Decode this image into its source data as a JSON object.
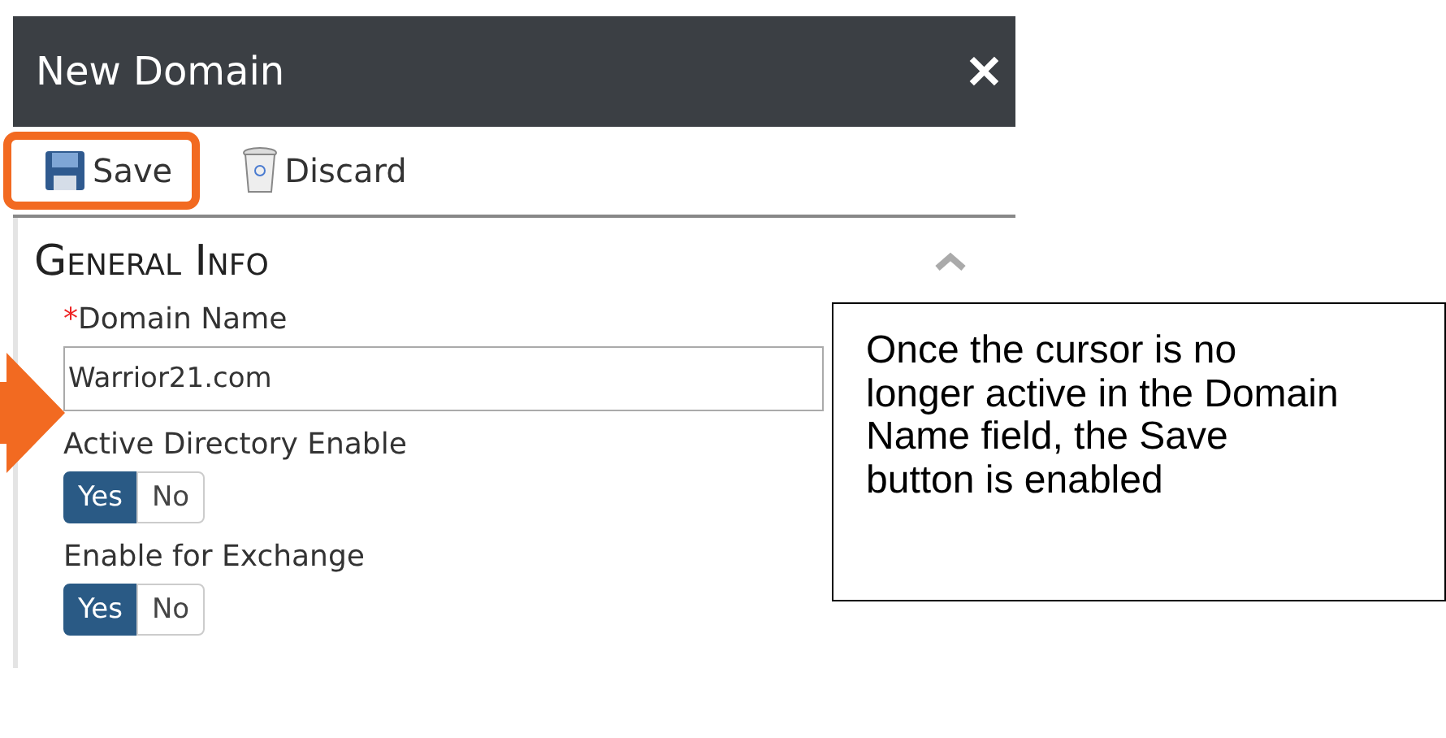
{
  "dialog": {
    "title": "New Domain",
    "close": "✕"
  },
  "toolbar": [
    {
      "label": "Save",
      "kind": "save",
      "highlighted": true
    },
    {
      "label": "Discard",
      "kind": "discard",
      "highlighted": false
    }
  ],
  "section": {
    "title": "General Info",
    "expanded": true
  },
  "fields": [
    {
      "kind": "text",
      "label": "Domain Name",
      "required_mark": "*",
      "value": "Warrior21.com",
      "pointed": true
    },
    {
      "kind": "toggle",
      "label": "Active Directory Enable",
      "options": [
        {
          "label": "Yes",
          "selected": true
        },
        {
          "label": "No",
          "selected": false
        }
      ]
    },
    {
      "kind": "toggle",
      "label": "Enable for Exchange",
      "options": [
        {
          "label": "Yes",
          "selected": true
        },
        {
          "label": "No",
          "selected": false
        }
      ]
    }
  ],
  "callout": "Once the cursor is no longer active in the Domain Name field, the Save button is enabled"
}
